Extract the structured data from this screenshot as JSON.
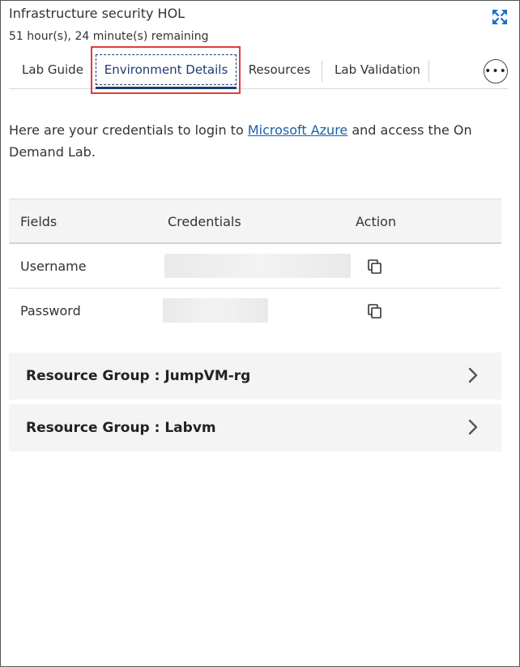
{
  "header": {
    "title": "Infrastructure security HOL",
    "timer": "51 hour(s), 24 minute(s) remaining",
    "expand_icon": "expand-arrows-icon"
  },
  "tabs": [
    {
      "label": "Lab Guide",
      "active": false
    },
    {
      "label": "Environment Details",
      "active": true
    },
    {
      "label": "Resources",
      "active": false
    },
    {
      "label": "Lab Validation",
      "active": false
    }
  ],
  "more_button": {
    "label": "•••"
  },
  "intro": {
    "before": "Here are your credentials to login to ",
    "link": "Microsoft Azure",
    "after": " and access the On Demand Lab."
  },
  "credentials_table": {
    "headers": [
      "Fields",
      "Credentials",
      "Action"
    ],
    "rows": [
      {
        "field": "Username",
        "value_masked": true,
        "action_icon": "copy-icon"
      },
      {
        "field": "Password",
        "value_masked": true,
        "action_icon": "copy-icon"
      }
    ]
  },
  "resource_groups": [
    {
      "label": "Resource Group : JumpVM-rg"
    },
    {
      "label": "Resource Group : Labvm"
    }
  ],
  "colors": {
    "accent": "#1e3c6e",
    "highlight": "#e23b3b",
    "link": "#1a5fa8",
    "panel_bg": "#f4f4f4"
  }
}
